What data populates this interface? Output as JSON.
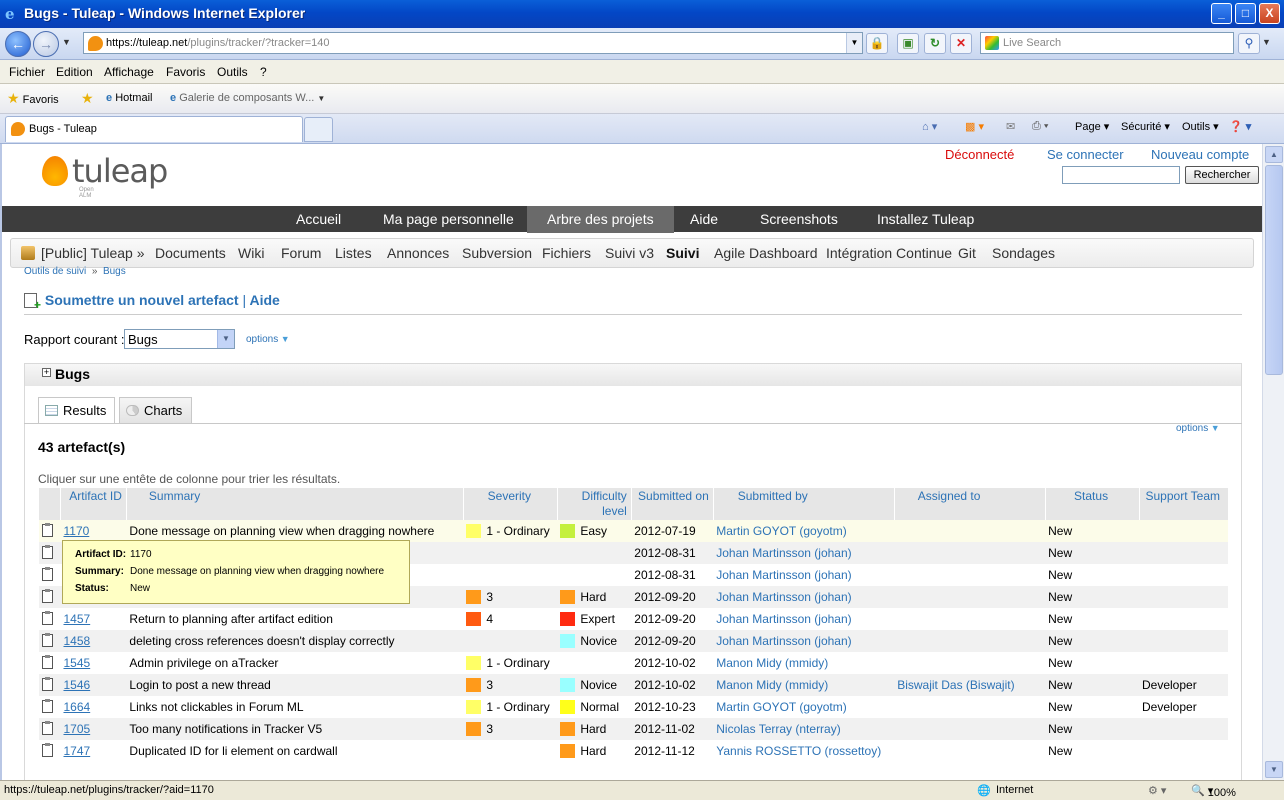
{
  "window": {
    "title": "Bugs - Tuleap - Windows Internet Explorer",
    "min": "_",
    "max": "□",
    "close": "X"
  },
  "address": {
    "url_main": "https://tuleap.net",
    "url_rest": "/plugins/tracker/?tracker=140",
    "search_placeholder": "Live Search"
  },
  "menubar": [
    "Fichier",
    "Edition",
    "Affichage",
    "Favoris",
    "Outils",
    "?"
  ],
  "favorites": {
    "label": "Favoris",
    "items": [
      "Hotmail",
      "Galerie de composants W..."
    ]
  },
  "browser_tab": {
    "label": "Bugs - Tuleap"
  },
  "command_bar": [
    "Page",
    "Sécurité",
    "Outils"
  ],
  "tuleap": {
    "logo_word": "tuleap",
    "logo_sub": "Open ALM",
    "status": "Déconnecté",
    "login": "Se connecter",
    "new_account": "Nouveau compte",
    "search_button": "Rechercher",
    "main_nav": [
      "Accueil",
      "Ma page personnelle",
      "Arbre des projets",
      "Aide",
      "Screenshots",
      "Installez Tuleap"
    ],
    "main_nav_active": "Arbre des projets",
    "project_nav": [
      "[Public] Tuleap »",
      "Documents",
      "Wiki",
      "Forum",
      "Listes",
      "Annonces",
      "Subversion",
      "Fichiers",
      "Suivi v3",
      "Suivi",
      "Agile Dashboard",
      "Intégration Continue",
      "Git",
      "Sondages"
    ],
    "project_nav_active": "Suivi",
    "breadcrumb": {
      "root": "Outils de suivi",
      "sep": "»",
      "current": "Bugs"
    },
    "submit_link": "Soumettre un nouvel artefact",
    "link_sep": "|",
    "help_link": "Aide",
    "report_label": "Rapport courant :",
    "report_value": "Bugs",
    "options": "options",
    "panel_title": "Bugs",
    "tabs": {
      "results": "Results",
      "charts": "Charts"
    },
    "count": "43 artefact(s)",
    "sort_hint": "Cliquer sur une entête de colonne pour trier les résultats.",
    "columns": [
      "Artifact ID",
      "Summary",
      "Severity",
      "Difficulty level",
      "Submitted on",
      "Submitted by",
      "Assigned to",
      "Status",
      "Support Team"
    ],
    "rows": [
      {
        "id": "1170",
        "summary": "Done message on planning view when dragging nowhere",
        "severity": "1 - Ordinary",
        "sev_color": "#ffff66",
        "difficulty": "Easy",
        "dif_color": "#c4f03c",
        "date": "2012-07-19",
        "by": "Martin GOYOT (goyotm)",
        "assigned": "",
        "status": "New",
        "team": ""
      },
      {
        "id": "",
        "summary": "",
        "severity": "",
        "sev_color": "",
        "difficulty": "",
        "dif_color": "",
        "date": "2012-08-31",
        "by": "Johan Martinsson (johan)",
        "assigned": "",
        "status": "New",
        "team": ""
      },
      {
        "id": "",
        "summary": "",
        "severity": "",
        "sev_color": "",
        "difficulty": "",
        "dif_color": "",
        "date": "2012-08-31",
        "by": "Johan Martinsson (johan)",
        "assigned": "",
        "status": "New",
        "team": ""
      },
      {
        "id": "",
        "summary": "",
        "severity": "3",
        "sev_color": "#ff9a1a",
        "difficulty": "Hard",
        "dif_color": "#ff9a1a",
        "date": "2012-09-20",
        "by": "Johan Martinsson (johan)",
        "assigned": "",
        "status": "New",
        "team": ""
      },
      {
        "id": "1457",
        "summary": "Return to planning after artifact edition",
        "severity": "4",
        "sev_color": "#ff5a10",
        "difficulty": "Expert",
        "dif_color": "#ff2a10",
        "date": "2012-09-20",
        "by": "Johan Martinsson (johan)",
        "assigned": "",
        "status": "New",
        "team": ""
      },
      {
        "id": "1458",
        "summary": "deleting cross references doesn't display correctly",
        "severity": "",
        "sev_color": "",
        "difficulty": "Novice",
        "dif_color": "#99ffff",
        "date": "2012-09-20",
        "by": "Johan Martinsson (johan)",
        "assigned": "",
        "status": "New",
        "team": ""
      },
      {
        "id": "1545",
        "summary": "Admin privilege on aTracker",
        "severity": "1 - Ordinary",
        "sev_color": "#ffff66",
        "difficulty": "",
        "dif_color": "",
        "date": "2012-10-02",
        "by": "Manon Midy (mmidy)",
        "assigned": "",
        "status": "New",
        "team": ""
      },
      {
        "id": "1546",
        "summary": "Login to post a new thread",
        "severity": "3",
        "sev_color": "#ff9a1a",
        "difficulty": "Novice",
        "dif_color": "#99ffff",
        "date": "2012-10-02",
        "by": "Manon Midy (mmidy)",
        "assigned": "Biswajit Das (Biswajit)",
        "status": "New",
        "team": "Developer"
      },
      {
        "id": "1664",
        "summary": "Links not clickables in Forum ML",
        "severity": "1 - Ordinary",
        "sev_color": "#ffff66",
        "difficulty": "Normal",
        "dif_color": "#ffff1a",
        "date": "2012-10-23",
        "by": "Martin GOYOT (goyotm)",
        "assigned": "",
        "status": "New",
        "team": "Developer"
      },
      {
        "id": "1705",
        "summary": "Too many notifications in Tracker V5",
        "severity": "3",
        "sev_color": "#ff9a1a",
        "difficulty": "Hard",
        "dif_color": "#ff9a1a",
        "date": "2012-11-02",
        "by": "Nicolas Terray (nterray)",
        "assigned": "",
        "status": "New",
        "team": ""
      },
      {
        "id": "1747",
        "summary": "Duplicated ID for li element on cardwall",
        "severity": "",
        "sev_color": "",
        "difficulty": "Hard",
        "dif_color": "#ff9a1a",
        "date": "2012-11-12",
        "by": "Yannis ROSSETTO (rossettoy)",
        "assigned": "",
        "status": "New",
        "team": ""
      }
    ],
    "tooltip": {
      "id_label": "Artifact ID:",
      "id": "1170",
      "summary_label": "Summary:",
      "summary": "Done message on planning view when dragging nowhere",
      "status_label": "Status:",
      "status": "New"
    }
  },
  "statusbar": {
    "url": "https://tuleap.net/plugins/tracker/?aid=1170",
    "zone": "Internet",
    "zoom": "100%"
  }
}
